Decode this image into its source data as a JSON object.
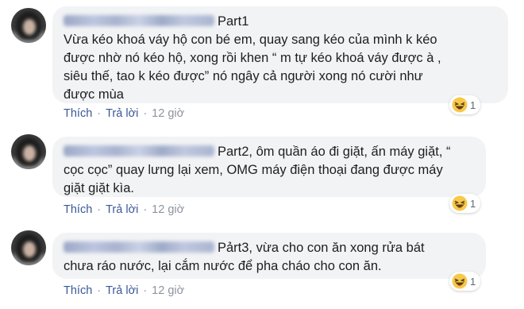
{
  "comments": [
    {
      "author_blurred": true,
      "text": "Part1\nVừa kéo khoá váy hộ con bé em, quay sang kéo của mình k kéo\nđược nhờ nó kéo hộ, xong rồi khen “ m tự kéo khoá váy được à ,\nsiêu thế, tao k kéo được” nó ngây cả người xong nó cười như\nđược mùa",
      "like_label": "Thích",
      "reply_label": "Trả lời",
      "time": "12 giờ",
      "reaction_icon": "haha-icon",
      "reaction_count": "1"
    },
    {
      "author_blurred": true,
      "text": "Part2, ôm quần áo đi giặt, ấn máy giặt, “\ncọc cọc” quay lưng lại xem, OMG máy điện thoại đang được máy\ngiặt giặt kìa.",
      "like_label": "Thích",
      "reply_label": "Trả lời",
      "time": "12 giờ",
      "reaction_icon": "haha-icon",
      "reaction_count": "1"
    },
    {
      "author_blurred": true,
      "text": "Pảrt3, vừa cho con ăn xong rửa bát\nchưa ráo nước, lại cắm nước để pha cháo cho con ăn.",
      "like_label": "Thích",
      "reply_label": "Trả lời",
      "time": "12 giờ",
      "reaction_icon": "haha-icon",
      "reaction_count": "1"
    }
  ],
  "colors": {
    "bubble": "#f2f3f5",
    "link": "#385898",
    "meta": "#8d949e",
    "haha": "#f7c94b"
  }
}
